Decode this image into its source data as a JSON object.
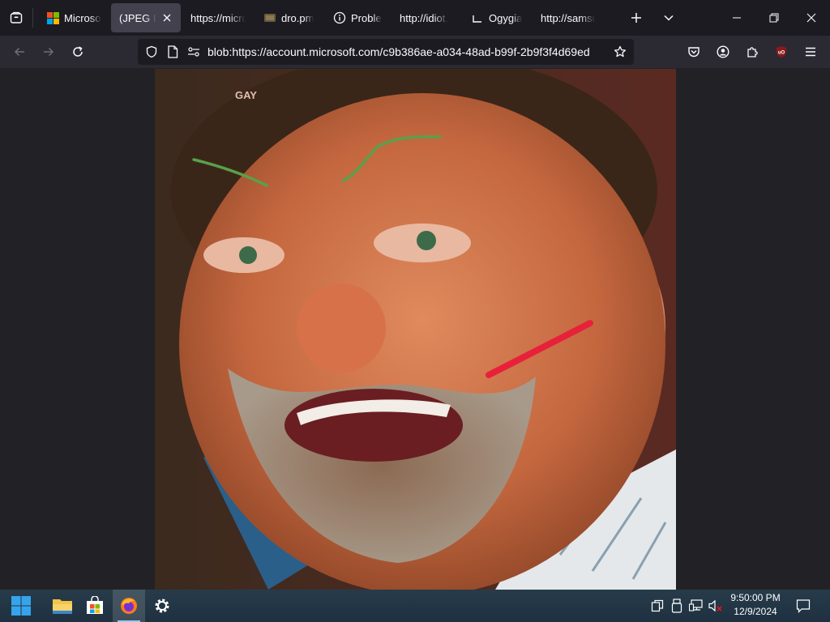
{
  "browser": {
    "tabs": [
      {
        "title": "Microsoft",
        "icon": "microsoft-logo-icon",
        "active": false
      },
      {
        "title": "(JPEG Image",
        "icon": "none",
        "active": true
      },
      {
        "title": "https://microsoft",
        "icon": "none",
        "active": false
      },
      {
        "title": "dro.pm",
        "icon": "page-icon",
        "active": false
      },
      {
        "title": "Problem",
        "icon": "info-icon",
        "active": false
      },
      {
        "title": "http://idiot.",
        "icon": "none",
        "active": false
      },
      {
        "title": "Ogygia",
        "icon": "ogygia-icon",
        "active": false
      },
      {
        "title": "http://samsung",
        "icon": "none",
        "active": false
      }
    ],
    "url": "blob:https://account.microsoft.com/c9b386ae-a034-48ad-b99f-2b9f3f4d69ed"
  },
  "image": {
    "overlay_text": "GAY"
  },
  "colors": {
    "tab_active_bg": "#42414d",
    "navbar_bg": "#2b2a33",
    "urlbar_bg": "#1c1b22",
    "taskbar_bg": "#243745",
    "ublock_red": "#8b1a1a",
    "green_scribble": "#5aa04a",
    "red_scribble": "#e8213a"
  },
  "taskbar": {
    "time": "9:50:00 PM",
    "date": "12/9/2024",
    "apps": [
      "start-button",
      "file-explorer",
      "microsoft-store",
      "firefox",
      "settings"
    ]
  }
}
